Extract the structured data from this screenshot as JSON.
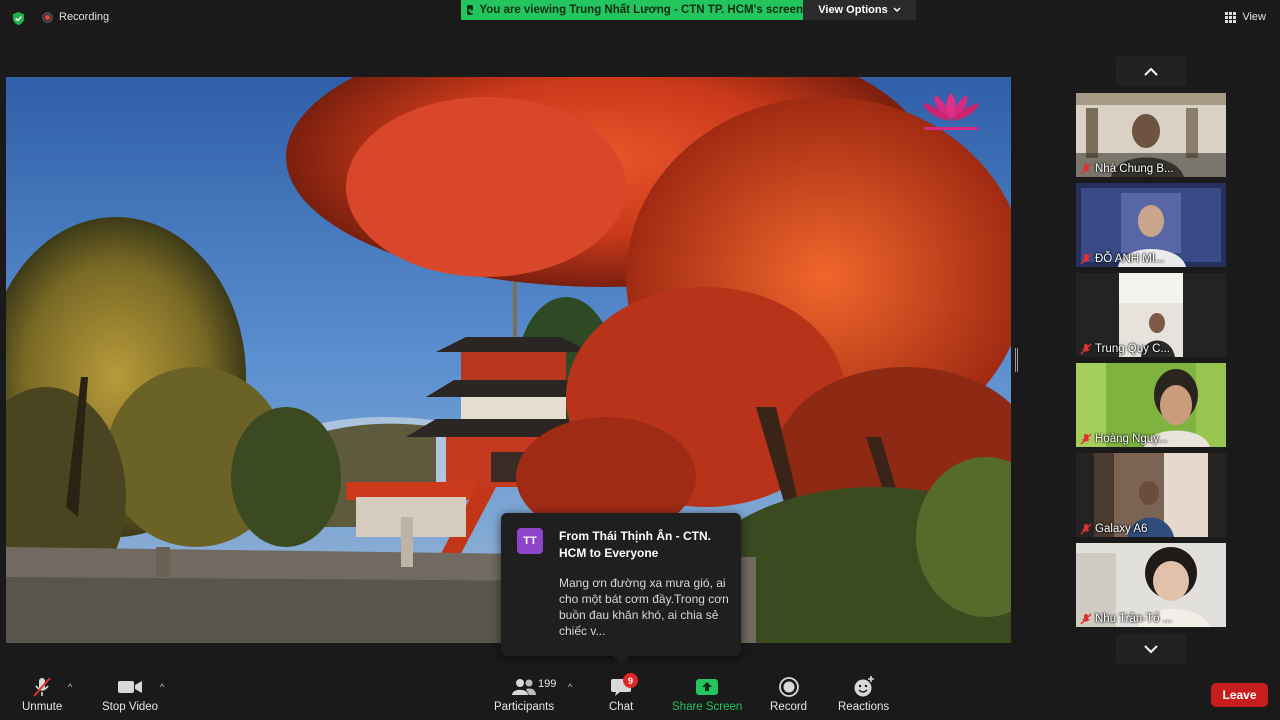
{
  "top_bar": {
    "recording_label": "Recording",
    "viewing_banner": "You are viewing Trung Nhất Lương - CTN TP. HCM's screen",
    "view_options_label": "View Options",
    "view_label": "View"
  },
  "chat_toast": {
    "avatar_initials": "TT",
    "from": "From Thái Thịnh Ân - CTN. HCM to Everyone",
    "message": "Mang ơn đường xa mưa gió, ai cho một bát cơm đầy.Trong cơn buồn đau khăn khó, ai chia sẻ chiếc v..."
  },
  "participants": [
    {
      "name": "Nhà Chung B..."
    },
    {
      "name": "ĐỖ ANH MI..."
    },
    {
      "name": "Trung Quy C..."
    },
    {
      "name": "Hoàng Nguy..."
    },
    {
      "name": "Galaxy A6"
    },
    {
      "name": "Nhu Trần-Tổ ..."
    }
  ],
  "toolbar": {
    "unmute_label": "Unmute",
    "stop_video_label": "Stop Video",
    "participants_label": "Participants",
    "participants_count": "199",
    "chat_label": "Chat",
    "chat_badge": "9",
    "share_screen_label": "Share Screen",
    "record_label": "Record",
    "reactions_label": "Reactions",
    "leave_label": "Leave"
  },
  "colors": {
    "banner_green": "#22c55e",
    "leave_red": "#c71d1d",
    "share_green": "#22c55e",
    "chat_avatar_purple": "#8e44c9"
  }
}
